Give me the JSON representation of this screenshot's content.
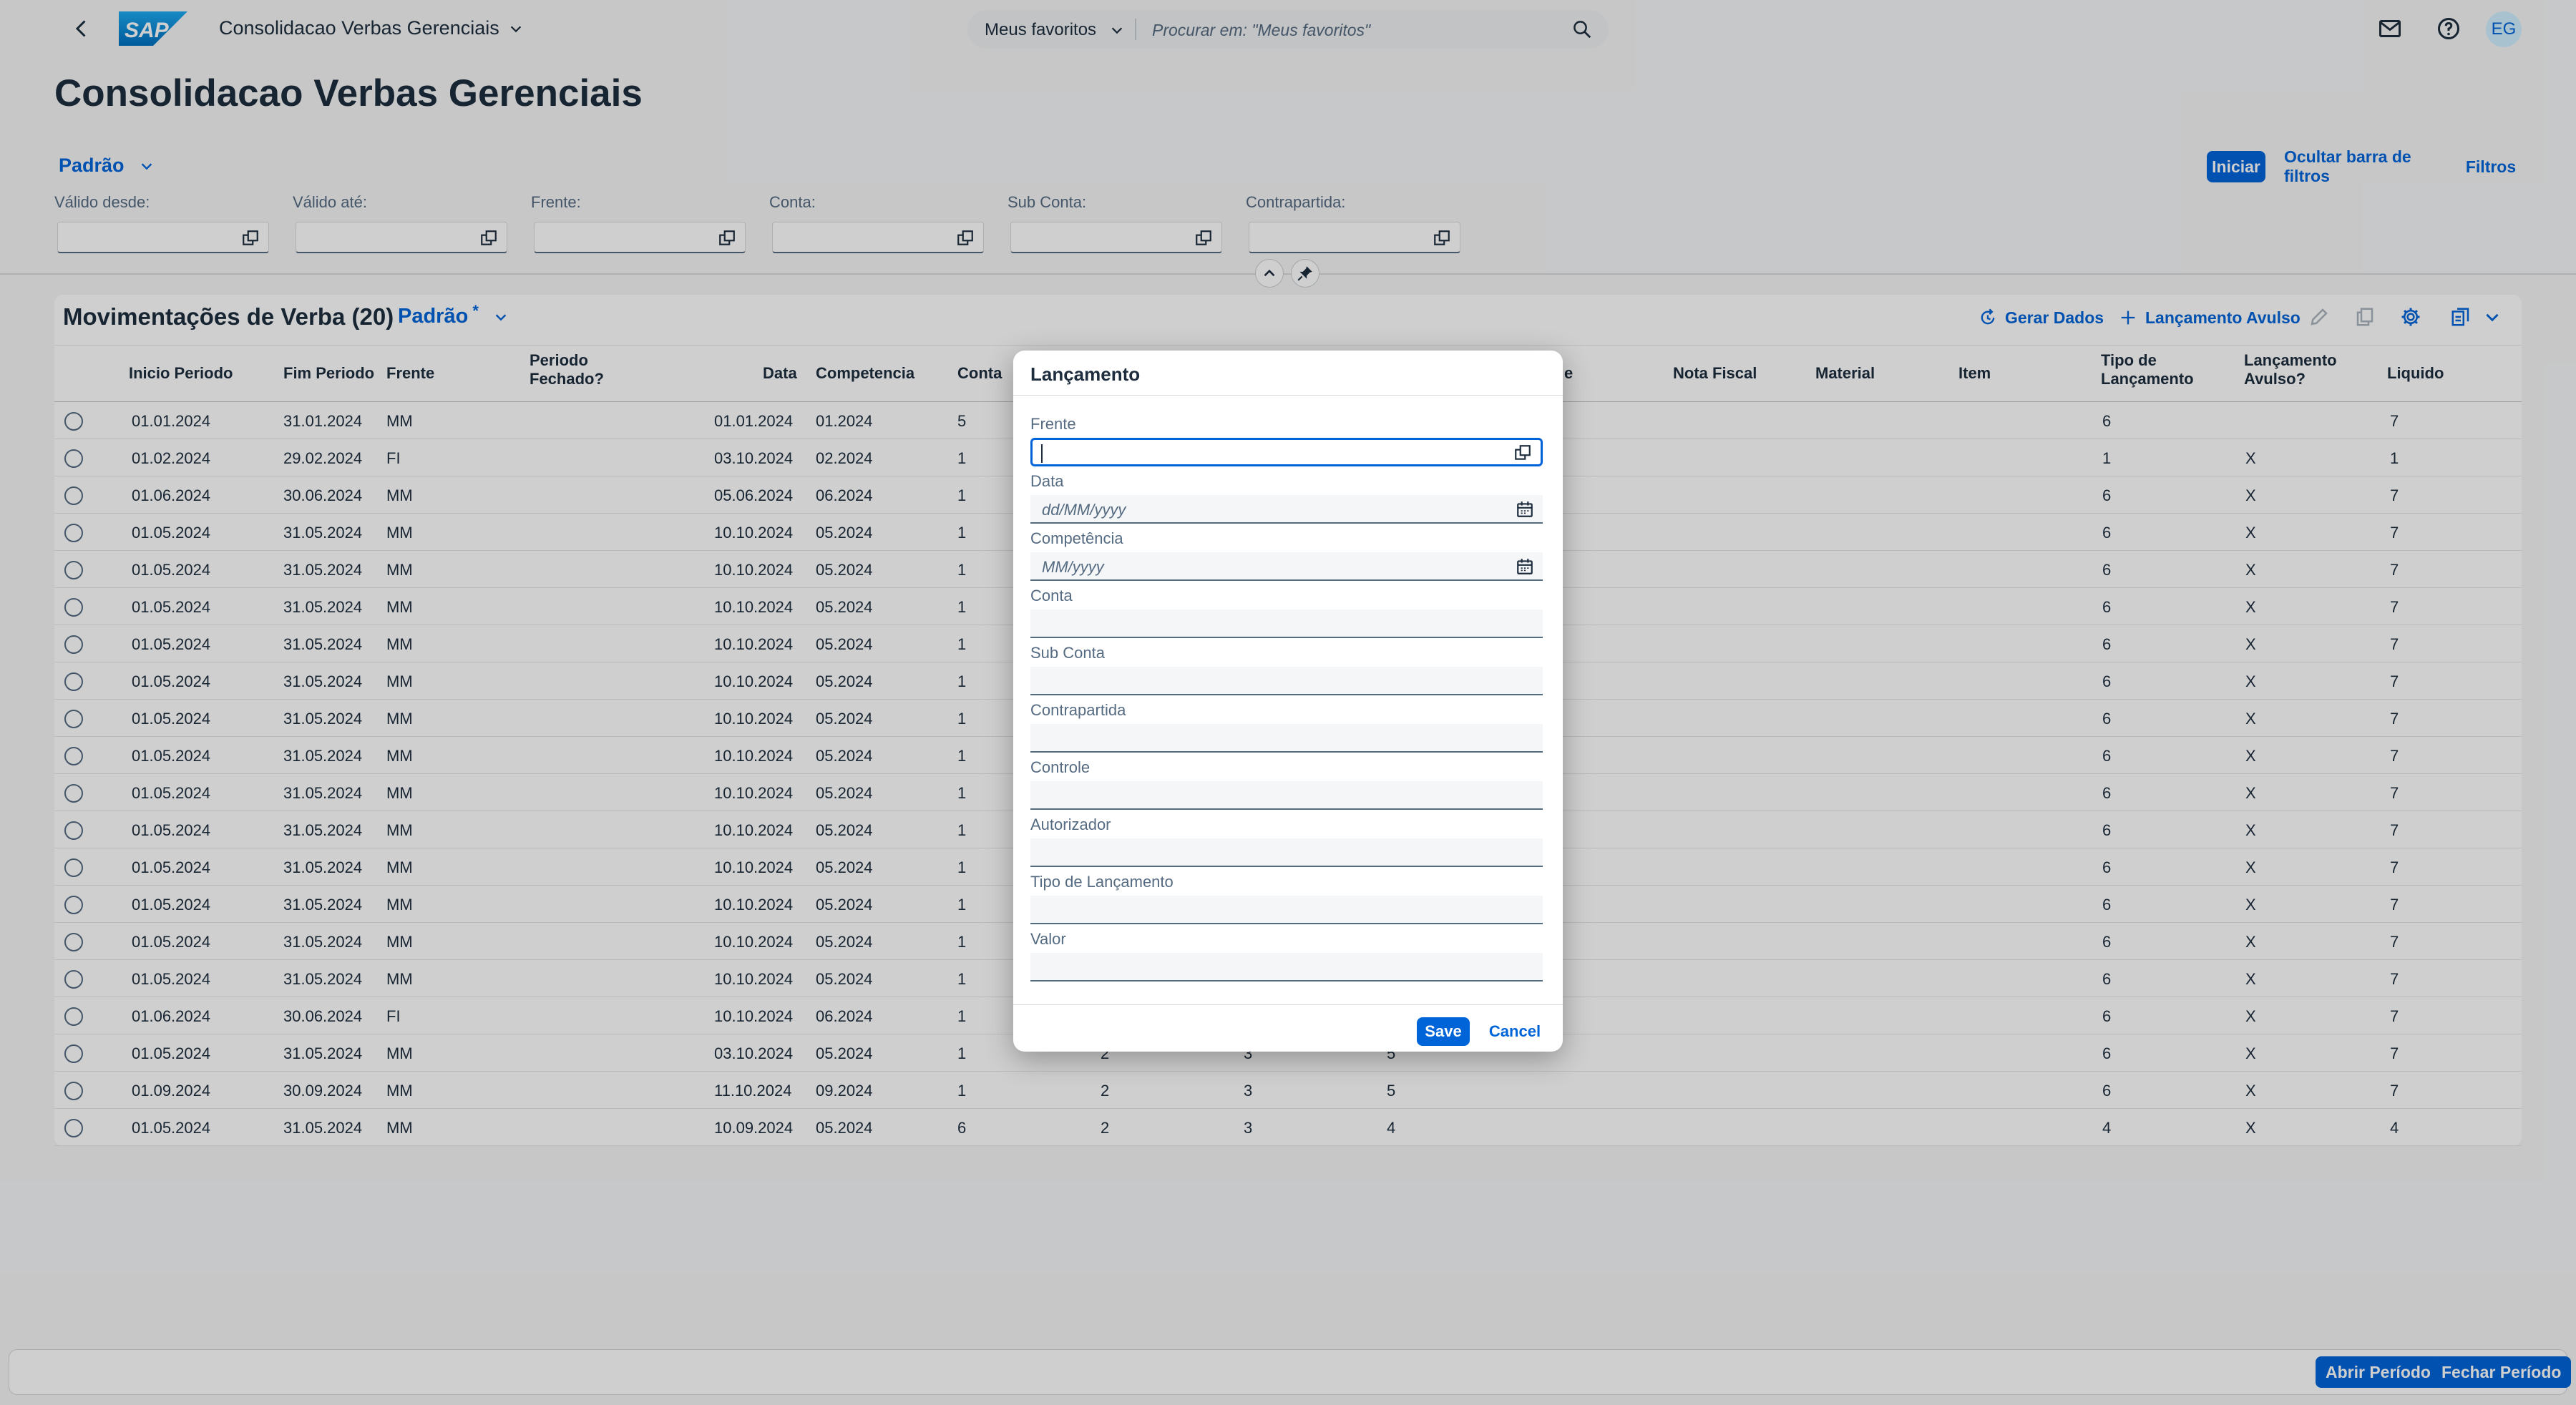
{
  "shell": {
    "app_title": "Consolidacao Verbas Gerenciais",
    "search_scope": "Meus favoritos",
    "search_placeholder": "Procurar em: \"Meus favoritos\"",
    "avatar": "EG",
    "logo_text": "SAP"
  },
  "header": {
    "title": "Consolidacao Verbas Gerenciais",
    "variant": "Padrão",
    "btn_go": "Iniciar",
    "btn_hide": "Ocultar barra de filtros",
    "btn_filters": "Filtros",
    "filters": [
      "Válido desde:",
      "Válido até:",
      "Frente:",
      "Conta:",
      "Sub Conta:",
      "Contrapartida:"
    ]
  },
  "table": {
    "title": "Movimentações de Verba (20)",
    "variant": "Padrão",
    "variant_modified": "*",
    "btn_gerar": "Gerar Dados",
    "btn_lancamento": "Lançamento Avulso",
    "columns": [
      "Inicio Periodo",
      "Fim Periodo",
      "Frente",
      "Periodo Fechado?",
      "Data",
      "Competencia",
      "Conta",
      "e",
      "Nota Fiscal",
      "Material",
      "Item",
      "Tipo de Lançamento",
      "Lançamento Avulso?",
      "Liquido"
    ],
    "rows": [
      {
        "inicio": "01.01.2024",
        "fim": "31.01.2024",
        "frente": "MM",
        "fechado": "",
        "data": "01.01.2024",
        "comp": "01.2024",
        "conta": "5",
        "c2": "",
        "c3": "",
        "c4": "",
        "tipo": "6",
        "avulso": "",
        "liquido": "7"
      },
      {
        "inicio": "01.02.2024",
        "fim": "29.02.2024",
        "frente": "FI",
        "fechado": "",
        "data": "03.10.2024",
        "comp": "02.2024",
        "conta": "1",
        "c2": "",
        "c3": "",
        "c4": "",
        "tipo": "1",
        "avulso": "X",
        "liquido": "1"
      },
      {
        "inicio": "01.06.2024",
        "fim": "30.06.2024",
        "frente": "MM",
        "fechado": "",
        "data": "05.06.2024",
        "comp": "06.2024",
        "conta": "1",
        "c2": "",
        "c3": "",
        "c4": "",
        "tipo": "6",
        "avulso": "X",
        "liquido": "7"
      },
      {
        "inicio": "01.05.2024",
        "fim": "31.05.2024",
        "frente": "MM",
        "fechado": "",
        "data": "10.10.2024",
        "comp": "05.2024",
        "conta": "1",
        "c2": "",
        "c3": "",
        "c4": "",
        "tipo": "6",
        "avulso": "X",
        "liquido": "7"
      },
      {
        "inicio": "01.05.2024",
        "fim": "31.05.2024",
        "frente": "MM",
        "fechado": "",
        "data": "10.10.2024",
        "comp": "05.2024",
        "conta": "1",
        "c2": "",
        "c3": "",
        "c4": "",
        "tipo": "6",
        "avulso": "X",
        "liquido": "7"
      },
      {
        "inicio": "01.05.2024",
        "fim": "31.05.2024",
        "frente": "MM",
        "fechado": "",
        "data": "10.10.2024",
        "comp": "05.2024",
        "conta": "1",
        "c2": "",
        "c3": "",
        "c4": "",
        "tipo": "6",
        "avulso": "X",
        "liquido": "7"
      },
      {
        "inicio": "01.05.2024",
        "fim": "31.05.2024",
        "frente": "MM",
        "fechado": "",
        "data": "10.10.2024",
        "comp": "05.2024",
        "conta": "1",
        "c2": "",
        "c3": "",
        "c4": "",
        "tipo": "6",
        "avulso": "X",
        "liquido": "7"
      },
      {
        "inicio": "01.05.2024",
        "fim": "31.05.2024",
        "frente": "MM",
        "fechado": "",
        "data": "10.10.2024",
        "comp": "05.2024",
        "conta": "1",
        "c2": "",
        "c3": "",
        "c4": "",
        "tipo": "6",
        "avulso": "X",
        "liquido": "7"
      },
      {
        "inicio": "01.05.2024",
        "fim": "31.05.2024",
        "frente": "MM",
        "fechado": "",
        "data": "10.10.2024",
        "comp": "05.2024",
        "conta": "1",
        "c2": "",
        "c3": "",
        "c4": "",
        "tipo": "6",
        "avulso": "X",
        "liquido": "7"
      },
      {
        "inicio": "01.05.2024",
        "fim": "31.05.2024",
        "frente": "MM",
        "fechado": "",
        "data": "10.10.2024",
        "comp": "05.2024",
        "conta": "1",
        "c2": "",
        "c3": "",
        "c4": "",
        "tipo": "6",
        "avulso": "X",
        "liquido": "7"
      },
      {
        "inicio": "01.05.2024",
        "fim": "31.05.2024",
        "frente": "MM",
        "fechado": "",
        "data": "10.10.2024",
        "comp": "05.2024",
        "conta": "1",
        "c2": "",
        "c3": "",
        "c4": "",
        "tipo": "6",
        "avulso": "X",
        "liquido": "7"
      },
      {
        "inicio": "01.05.2024",
        "fim": "31.05.2024",
        "frente": "MM",
        "fechado": "",
        "data": "10.10.2024",
        "comp": "05.2024",
        "conta": "1",
        "c2": "",
        "c3": "",
        "c4": "",
        "tipo": "6",
        "avulso": "X",
        "liquido": "7"
      },
      {
        "inicio": "01.05.2024",
        "fim": "31.05.2024",
        "frente": "MM",
        "fechado": "",
        "data": "10.10.2024",
        "comp": "05.2024",
        "conta": "1",
        "c2": "",
        "c3": "",
        "c4": "",
        "tipo": "6",
        "avulso": "X",
        "liquido": "7"
      },
      {
        "inicio": "01.05.2024",
        "fim": "31.05.2024",
        "frente": "MM",
        "fechado": "",
        "data": "10.10.2024",
        "comp": "05.2024",
        "conta": "1",
        "c2": "",
        "c3": "",
        "c4": "",
        "tipo": "6",
        "avulso": "X",
        "liquido": "7"
      },
      {
        "inicio": "01.05.2024",
        "fim": "31.05.2024",
        "frente": "MM",
        "fechado": "",
        "data": "10.10.2024",
        "comp": "05.2024",
        "conta": "1",
        "c2": "",
        "c3": "",
        "c4": "",
        "tipo": "6",
        "avulso": "X",
        "liquido": "7"
      },
      {
        "inicio": "01.05.2024",
        "fim": "31.05.2024",
        "frente": "MM",
        "fechado": "",
        "data": "10.10.2024",
        "comp": "05.2024",
        "conta": "1",
        "c2": "",
        "c3": "",
        "c4": "",
        "tipo": "6",
        "avulso": "X",
        "liquido": "7"
      },
      {
        "inicio": "01.06.2024",
        "fim": "30.06.2024",
        "frente": "FI",
        "fechado": "",
        "data": "10.10.2024",
        "comp": "06.2024",
        "conta": "1",
        "c2": "",
        "c3": "",
        "c4": "",
        "tipo": "6",
        "avulso": "X",
        "liquido": "7"
      },
      {
        "inicio": "01.05.2024",
        "fim": "31.05.2024",
        "frente": "MM",
        "fechado": "",
        "data": "03.10.2024",
        "comp": "05.2024",
        "conta": "1",
        "c2": "2",
        "c3": "3",
        "c4": "5",
        "tipo": "6",
        "avulso": "X",
        "liquido": "7"
      },
      {
        "inicio": "01.09.2024",
        "fim": "30.09.2024",
        "frente": "MM",
        "fechado": "",
        "data": "11.10.2024",
        "comp": "09.2024",
        "conta": "1",
        "c2": "2",
        "c3": "3",
        "c4": "5",
        "tipo": "6",
        "avulso": "X",
        "liquido": "7"
      },
      {
        "inicio": "01.05.2024",
        "fim": "31.05.2024",
        "frente": "MM",
        "fechado": "",
        "data": "10.09.2024",
        "comp": "05.2024",
        "conta": "6",
        "c2": "2",
        "c3": "3",
        "c4": "4",
        "tipo": "4",
        "avulso": "X",
        "liquido": "4"
      }
    ]
  },
  "footer": {
    "btn_abrir": "Abrir Período",
    "btn_fechar": "Fechar Período"
  },
  "dialog": {
    "title": "Lançamento",
    "fields": [
      {
        "label": "Frente",
        "placeholder": ""
      },
      {
        "label": "Data",
        "placeholder": "dd/MM/yyyy"
      },
      {
        "label": "Competência",
        "placeholder": "MM/yyyy"
      },
      {
        "label": "Conta",
        "placeholder": ""
      },
      {
        "label": "Sub Conta",
        "placeholder": ""
      },
      {
        "label": "Contrapartida",
        "placeholder": ""
      },
      {
        "label": "Controle",
        "placeholder": ""
      },
      {
        "label": "Autorizador",
        "placeholder": ""
      },
      {
        "label": "Tipo de Lançamento",
        "placeholder": ""
      },
      {
        "label": "Valor",
        "placeholder": ""
      }
    ],
    "save": "Save",
    "cancel": "Cancel"
  },
  "colors": {
    "accent": "#0064d9",
    "text": "#1d2d3e",
    "muted": "#556b82",
    "background": "#f5f6f7"
  }
}
